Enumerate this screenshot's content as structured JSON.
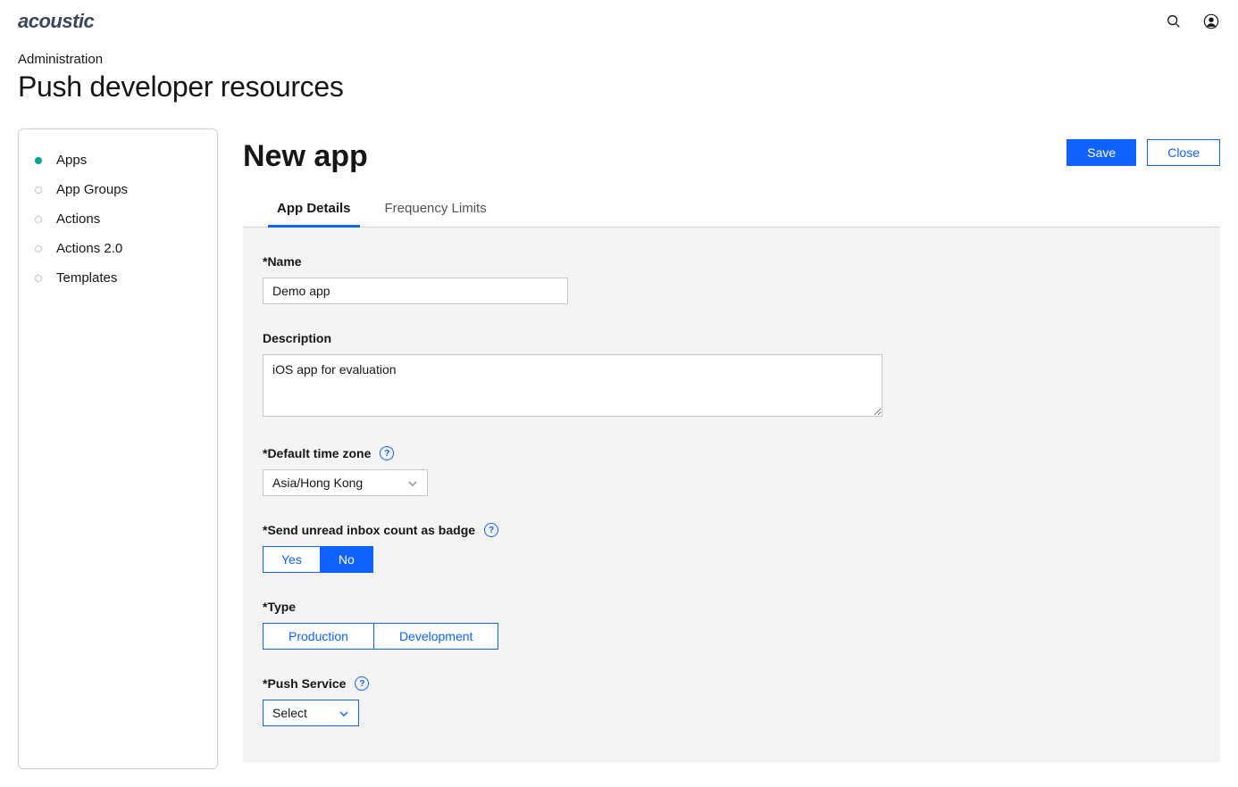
{
  "brand": "acoustic",
  "breadcrumb": "Administration",
  "pageTitle": "Push developer resources",
  "sidebar": {
    "items": [
      {
        "label": "Apps",
        "active": true
      },
      {
        "label": "App Groups",
        "active": false
      },
      {
        "label": "Actions",
        "active": false
      },
      {
        "label": "Actions 2.0",
        "active": false
      },
      {
        "label": "Templates",
        "active": false
      }
    ]
  },
  "main": {
    "title": "New app",
    "actions": {
      "save": "Save",
      "close": "Close"
    },
    "tabs": [
      {
        "label": "App Details",
        "active": true
      },
      {
        "label": "Frequency Limits",
        "active": false
      }
    ]
  },
  "form": {
    "name": {
      "label": "*Name",
      "value": "Demo app"
    },
    "description": {
      "label": "Description",
      "value": "iOS app for evaluation"
    },
    "timezone": {
      "label": "*Default time zone",
      "value": "Asia/Hong Kong"
    },
    "badge": {
      "label": "*Send unread inbox count as badge",
      "options": {
        "yes": "Yes",
        "no": "No"
      },
      "selected": "no"
    },
    "type": {
      "label": "*Type",
      "options": {
        "production": "Production",
        "development": "Development"
      }
    },
    "pushService": {
      "label": "*Push Service",
      "value": "Select"
    }
  }
}
